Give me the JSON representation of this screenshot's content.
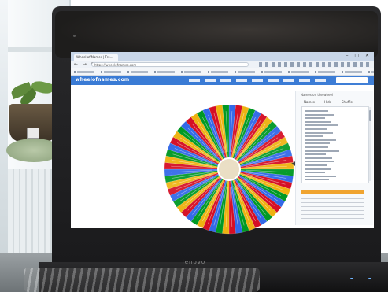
{
  "browser": {
    "tab_title": "Wheel of Names | Fre...",
    "url": "https://wheelofnames.com",
    "window_controls": "– ▢ ✕",
    "nav_arrows": "← → ⟳"
  },
  "site": {
    "logo_text": "wheelofnames.com"
  },
  "panel": {
    "header": "Names on the wheel",
    "tabs": [
      "Names",
      "Hide",
      "Shuffle"
    ]
  },
  "laptop": {
    "brand": "lenovo"
  },
  "wheel": {
    "segment_colors": [
      "#3369e8",
      "#d50f25",
      "#eeb211",
      "#009925"
    ],
    "segment_count": 60,
    "hub_color": "#e8dcc0"
  },
  "colors": {
    "site_nav": "#3a7bd5",
    "ad_accent": "#f0a430"
  }
}
